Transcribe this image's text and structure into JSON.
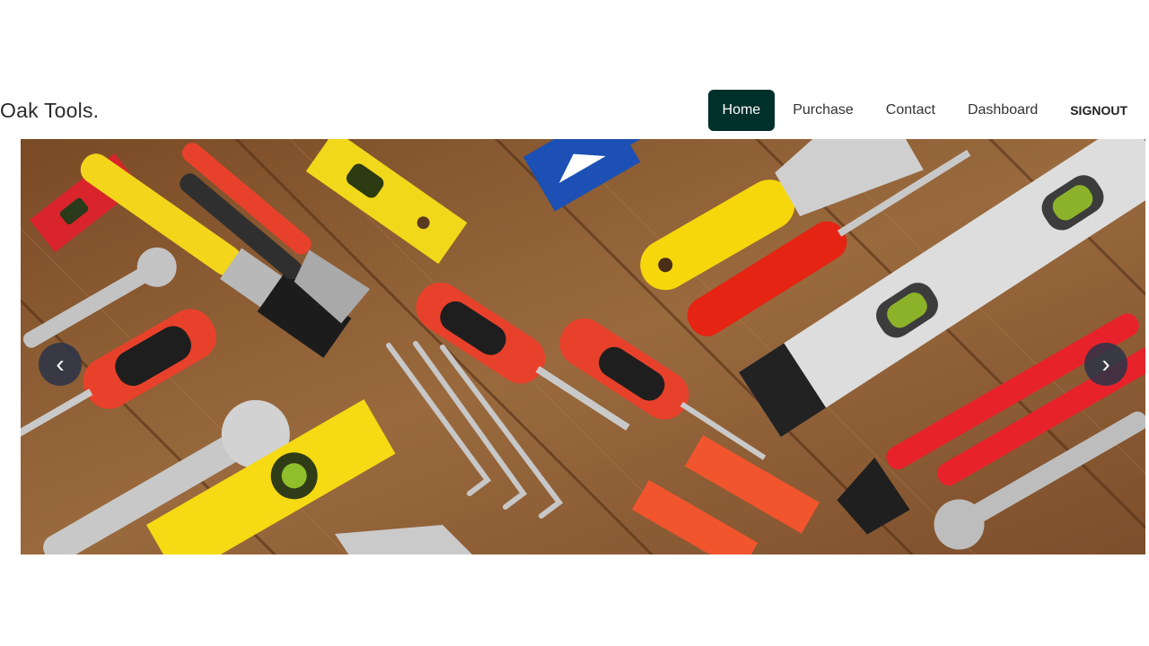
{
  "brand": "Oak Tools.",
  "nav": {
    "items": [
      {
        "label": "Home",
        "active": true
      },
      {
        "label": "Purchase"
      },
      {
        "label": "Contact"
      },
      {
        "label": "Dashboard"
      }
    ],
    "signout": "SIGNOUT"
  },
  "carousel": {
    "prev_icon": "‹",
    "next_icon": "›"
  },
  "colors": {
    "active_nav_bg": "#00302b",
    "wood": "#8a5a32",
    "tool_red": "#e8412b",
    "tool_yellow": "#f5d90a",
    "tool_blue": "#1a4fb0"
  }
}
